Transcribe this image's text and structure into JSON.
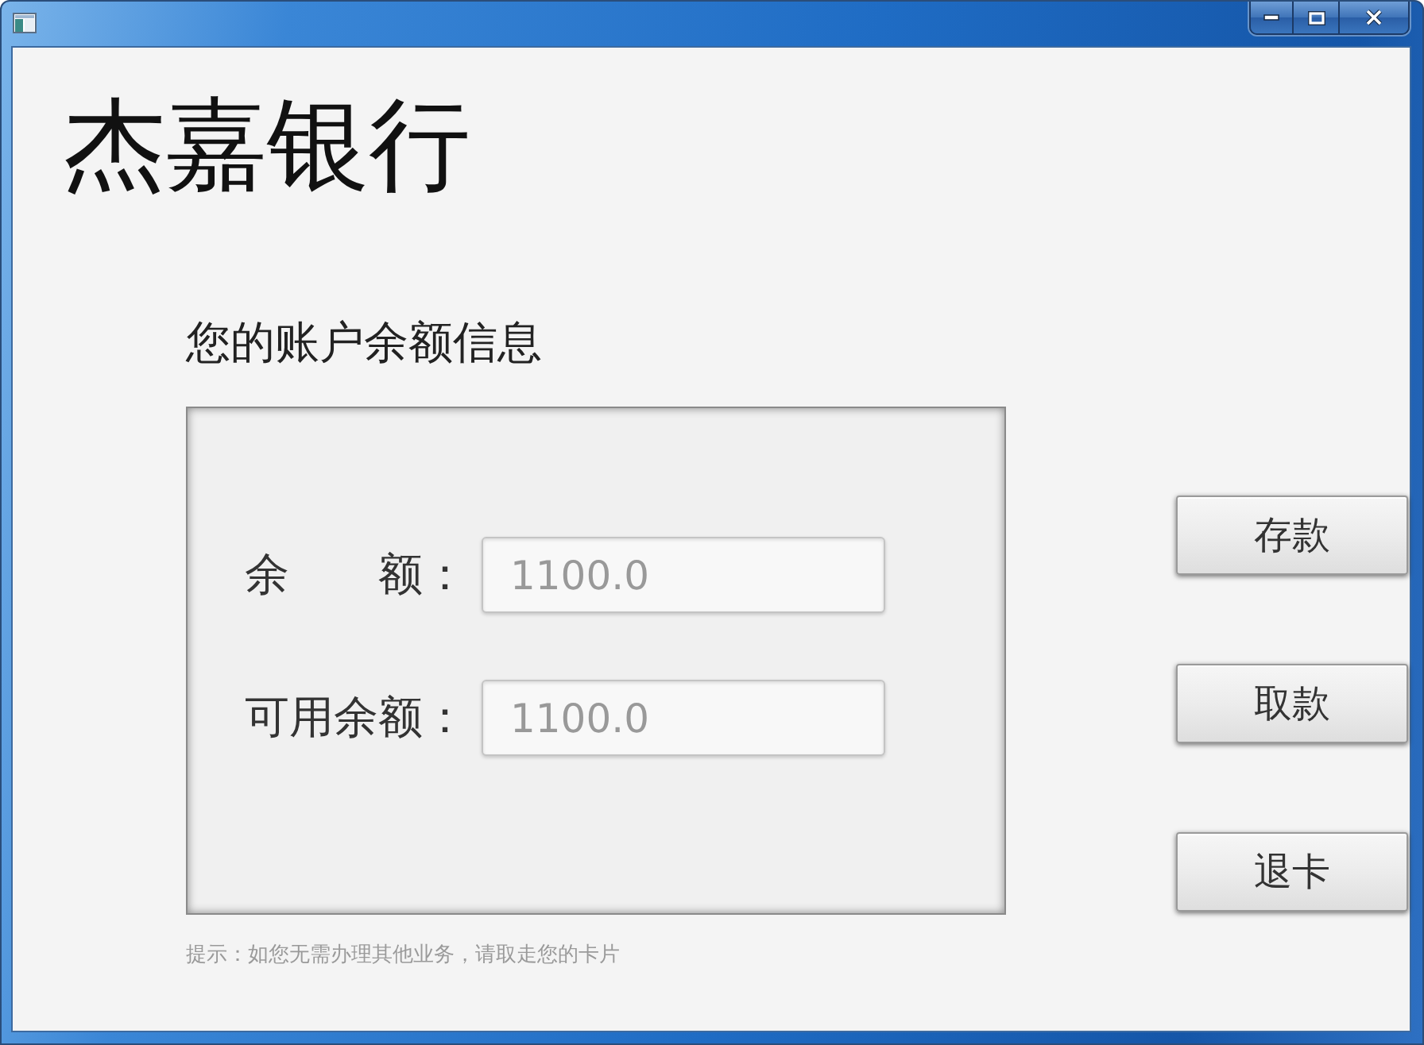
{
  "title": "杰嘉银行",
  "section_title": "您的账户余额信息",
  "balance_fields": [
    {
      "label": "余　　额：",
      "value": "1100.0"
    },
    {
      "label": "可用余额：",
      "value": "1100.0"
    }
  ],
  "hint": "提示：如您无需办理其他业务，请取走您的卡片",
  "buttons": [
    {
      "label": "存款"
    },
    {
      "label": "取款"
    },
    {
      "label": "退卡"
    }
  ]
}
